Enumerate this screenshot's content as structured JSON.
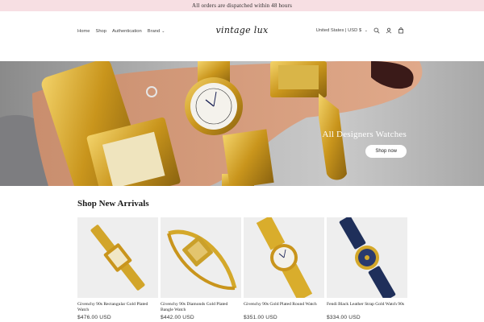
{
  "announcement": {
    "text": "All orders are dispatched within 48 hours"
  },
  "header": {
    "nav": [
      {
        "label": "Home"
      },
      {
        "label": "Shop"
      },
      {
        "label": "Authentication"
      },
      {
        "label": "Brand"
      }
    ],
    "logo": "vintage lux",
    "country_selector": "United States | USD $",
    "icons": [
      "search-icon",
      "account-icon",
      "cart-icon"
    ]
  },
  "hero": {
    "heading": "All Designers Watches",
    "button_label": "Shop now"
  },
  "section": {
    "title": "Shop New Arrivals"
  },
  "products": [
    {
      "title": "Givenchy 90s Rectangular Gold Plated Watch",
      "price": "$476.00 USD"
    },
    {
      "title": "Givenchy 90s Diamonds Gold Plated Bangle Watch",
      "price": "$442.00 USD"
    },
    {
      "title": "Givenchy 90s Gold Plated Round Watch",
      "price": "$351.00 USD"
    },
    {
      "title": "Fendi Black Leather Strap Gold Watch 90s",
      "price": "$334.00 USD"
    }
  ],
  "colors": {
    "announcement_bg": "#f7dfe3",
    "gold": "#d4a82a",
    "strap_navy": "#1f2f5a"
  }
}
